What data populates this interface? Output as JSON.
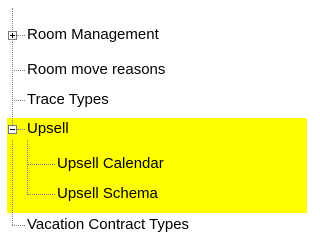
{
  "tree": {
    "items": [
      {
        "label": "Room Management",
        "state": "collapsed",
        "highlighted": false
      },
      {
        "label": "Room move reasons",
        "state": "leaf",
        "highlighted": false
      },
      {
        "label": "Trace Types",
        "state": "leaf",
        "highlighted": false
      },
      {
        "label": "Upsell",
        "state": "expanded",
        "highlighted": true
      },
      {
        "label": "Upsell Calendar",
        "state": "leaf",
        "highlighted": true
      },
      {
        "label": "Upsell Schema",
        "state": "leaf",
        "highlighted": true
      },
      {
        "label": "Vacation Contract Types",
        "state": "leaf",
        "highlighted": false
      }
    ],
    "highlight_color": "#ffff00",
    "line_color": "#808080"
  }
}
